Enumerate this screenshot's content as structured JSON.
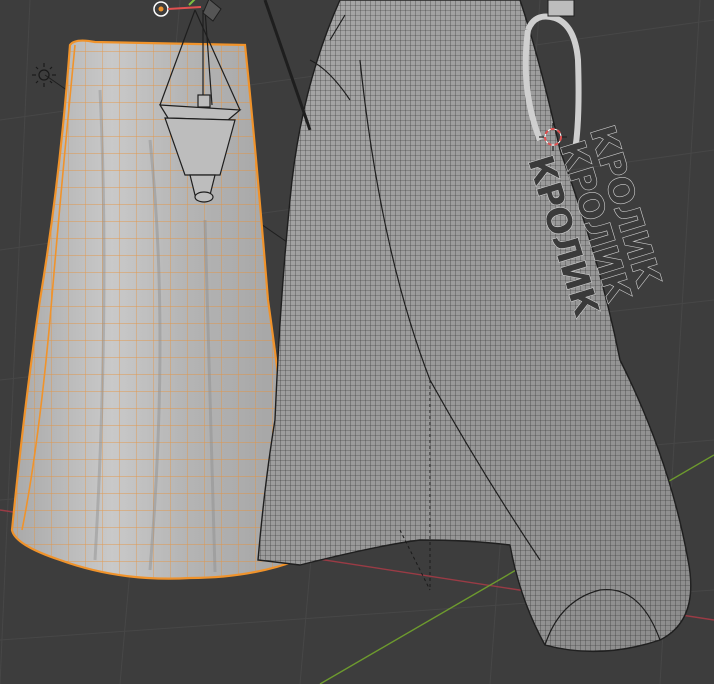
{
  "app": "3D viewport",
  "viewport": {
    "mode": "edit-mode-wireframe-overlay",
    "background_color": "#3d3d3d",
    "grid_color": "#4a4a4a",
    "axis_x_color": "#9a3b45",
    "axis_y_color": "#6d9a2e",
    "selection_color": "#f0932b"
  },
  "scene": {
    "objects": [
      {
        "name": "skirt-selected",
        "selected": true
      },
      {
        "name": "coat-draped",
        "selected": false
      },
      {
        "name": "lantern",
        "selected": false
      },
      {
        "name": "keychain-tags",
        "selected": false
      }
    ],
    "text_objects": [
      {
        "text": "КРОЛИК"
      },
      {
        "text": "КРОЛИК"
      },
      {
        "text": "КРОЛИК"
      }
    ]
  },
  "gizmos": {
    "light_icon": "sun-light-icon",
    "cursor_icon": "3d-cursor-icon",
    "origin_icon": "object-origin-icon"
  }
}
